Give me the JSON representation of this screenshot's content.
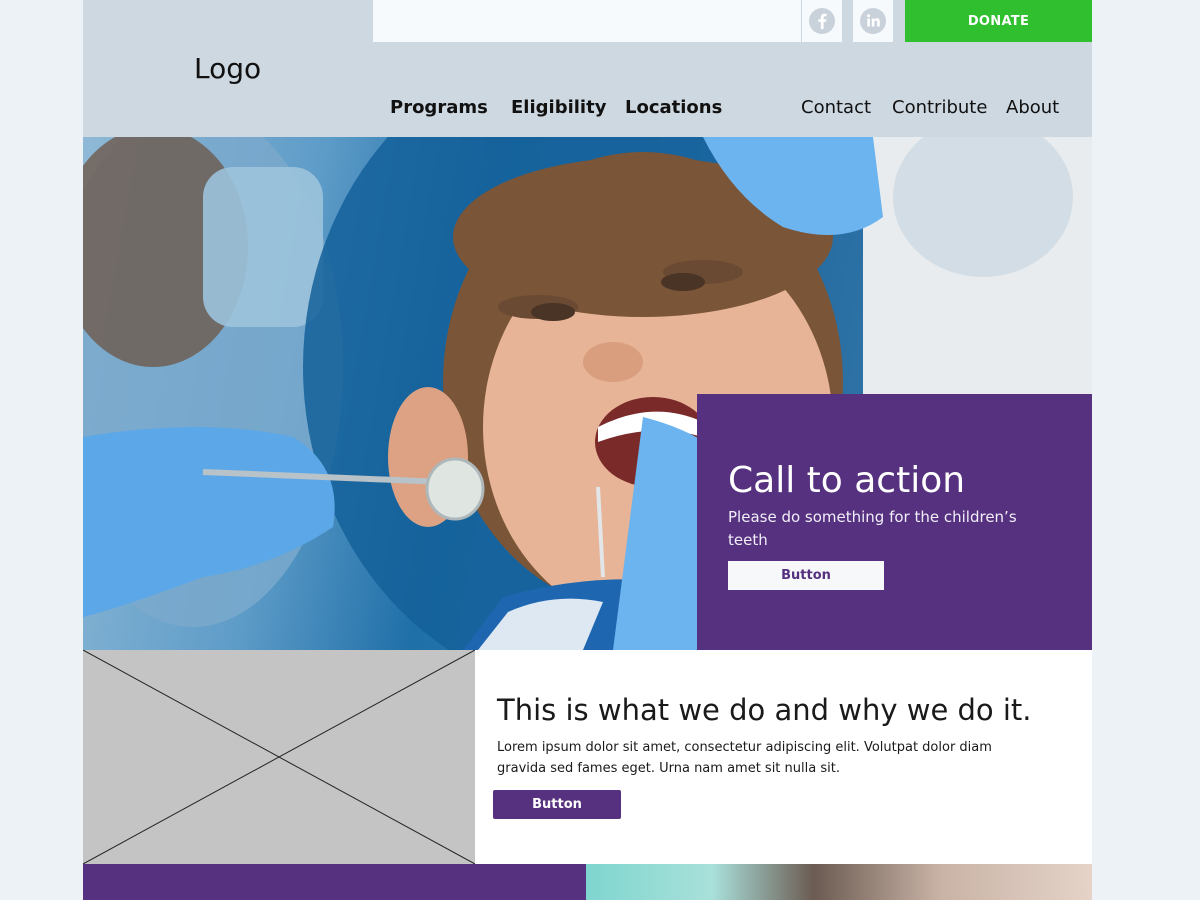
{
  "header": {
    "logo": "Logo",
    "donate_label": "DONATE",
    "social": [
      {
        "icon": "facebook-icon"
      },
      {
        "icon": "linkedin-icon"
      }
    ],
    "nav_primary": [
      {
        "label": "Programs"
      },
      {
        "label": "Eligibility"
      },
      {
        "label": "Locations"
      }
    ],
    "nav_secondary": [
      {
        "label": "Contact"
      },
      {
        "label": "Contribute"
      },
      {
        "label": "About"
      }
    ]
  },
  "hero": {
    "cta_title": "Call to action",
    "cta_subtitle": "Please do something for the children’s teeth",
    "cta_button": "Button"
  },
  "about": {
    "title": "This is what we do and why we do it.",
    "body": "Lorem ipsum dolor sit amet, consectetur adipiscing elit. Volutpat dolor diam gravida sed fames eget. Urna nam amet sit nulla sit.",
    "button": "Button"
  },
  "colors": {
    "brand_purple": "#55317f",
    "donate_green": "#2fbf2f",
    "header_bg": "#ced8e1",
    "page_bg": "#edf2f7"
  }
}
